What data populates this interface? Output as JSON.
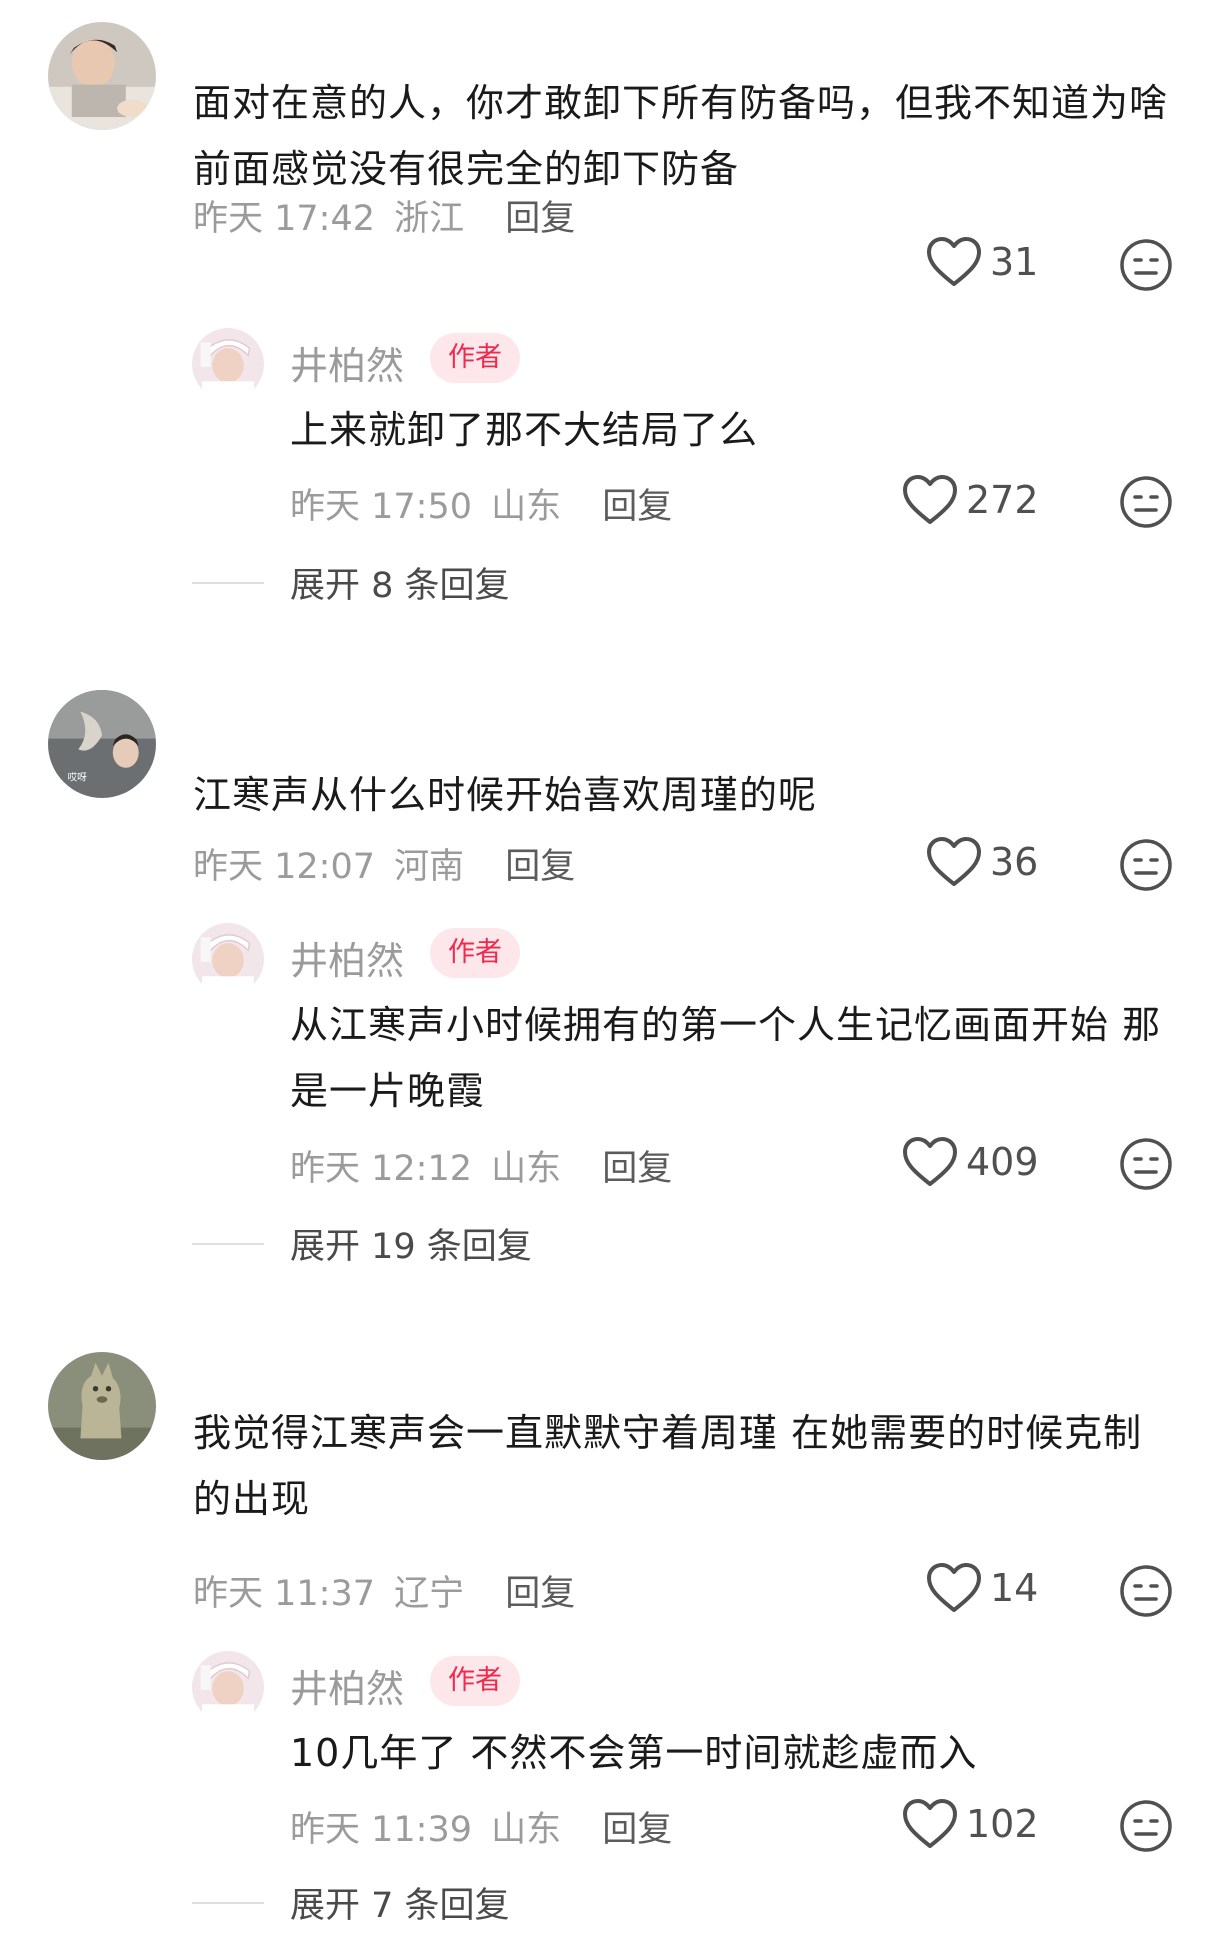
{
  "comments": [
    {
      "text": "面对在意的人，你才敢卸下所有防备吗，但我不知道为啥前面感觉没有很完全的卸下防备",
      "time": "昨天 17:42",
      "location": "浙江",
      "reply_label": "回复",
      "likes": "31",
      "author_reply": {
        "name": "井柏然",
        "badge": "作者",
        "text": "上来就卸了那不大结局了么",
        "time": "昨天 17:50",
        "location": "山东",
        "reply_label": "回复",
        "likes": "272"
      },
      "expand_label": "展开 8 条回复"
    },
    {
      "avatar_caption": "哎呀",
      "text": "江寒声从什么时候开始喜欢周瑾的呢",
      "time": "昨天 12:07",
      "location": "河南",
      "reply_label": "回复",
      "likes": "36",
      "author_reply": {
        "name": "井柏然",
        "badge": "作者",
        "text": "从江寒声小时候拥有的第一个人生记忆画面开始 那是一片晚霞",
        "time": "昨天 12:12",
        "location": "山东",
        "reply_label": "回复",
        "likes": "409"
      },
      "expand_label": "展开 19 条回复"
    },
    {
      "text": "我觉得江寒声会一直默默守着周瑾 在她需要的时候克制的出现",
      "time": "昨天 11:37",
      "location": "辽宁",
      "reply_label": "回复",
      "likes": "14",
      "author_reply": {
        "name": "井柏然",
        "badge": "作者",
        "text": "10几年了 不然不会第一时间就趁虚而入",
        "time": "昨天 11:39",
        "location": "山东",
        "reply_label": "回复",
        "likes": "102"
      },
      "expand_label": "展开 7 条回复"
    }
  ],
  "icons": {
    "like": "heart-outline-icon",
    "dislike": "meh-face-icon"
  },
  "colors": {
    "badge_bg": "#fde7ea",
    "badge_text": "#f0294d",
    "meta_text": "#9b9b9b"
  }
}
